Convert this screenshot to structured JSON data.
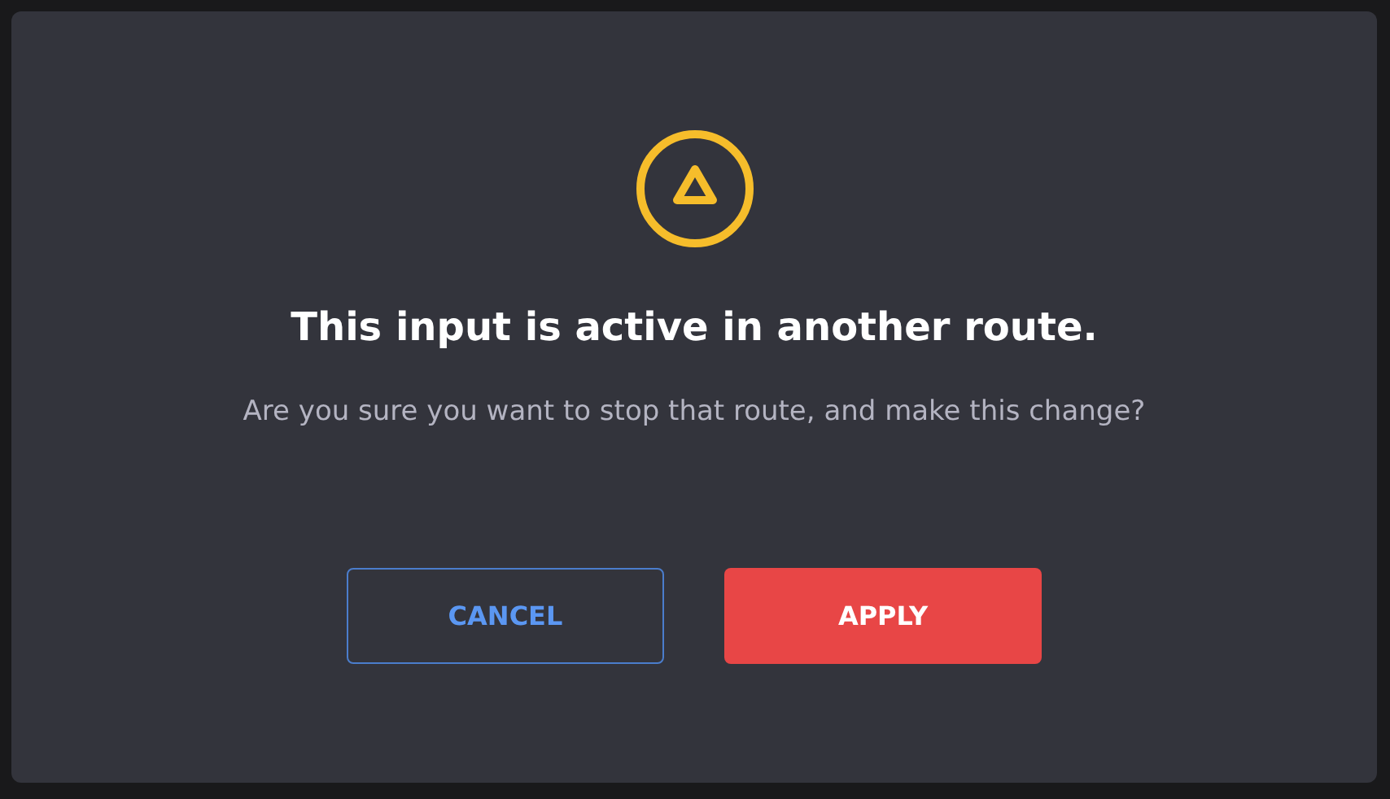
{
  "dialog": {
    "title": "This input is active in another route.",
    "message": "Are you sure you want to stop that route, and make this change?",
    "buttons": [
      {
        "label": "CANCEL",
        "kind": "secondary"
      },
      {
        "label": "APPLY",
        "kind": "primary"
      }
    ]
  }
}
